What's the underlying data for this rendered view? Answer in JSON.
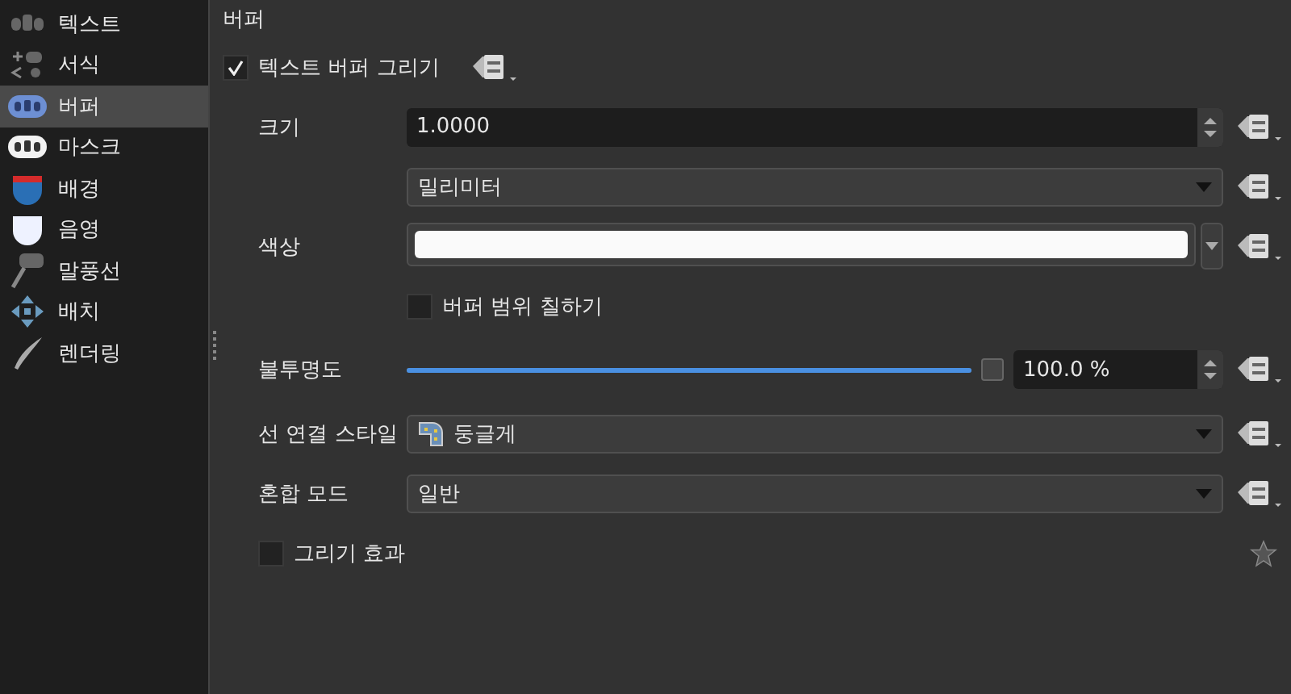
{
  "sidebar": {
    "items": [
      {
        "label": "텍스트",
        "kind": "text",
        "selected": false
      },
      {
        "label": "서식",
        "kind": "format",
        "selected": false
      },
      {
        "label": "버퍼",
        "kind": "buffer",
        "selected": true
      },
      {
        "label": "마스크",
        "kind": "mask",
        "selected": false
      },
      {
        "label": "배경",
        "kind": "background",
        "selected": false
      },
      {
        "label": "음영",
        "kind": "shadow",
        "selected": false
      },
      {
        "label": "말풍선",
        "kind": "callout",
        "selected": false
      },
      {
        "label": "배치",
        "kind": "placement",
        "selected": false
      },
      {
        "label": "렌더링",
        "kind": "rendering",
        "selected": false
      }
    ]
  },
  "panel": {
    "title": "버퍼",
    "enable": {
      "label": "텍스트 버퍼 그리기",
      "checked": true
    },
    "size": {
      "label": "크기",
      "value": "1.0000"
    },
    "unit": {
      "value": "밀리미터"
    },
    "color": {
      "label": "색상"
    },
    "fill": {
      "label": "버퍼 범위 칠하기",
      "checked": false
    },
    "opacity": {
      "label": "불투명도",
      "level": 1,
      "value": "100.0 %"
    },
    "join": {
      "label": "선 연결 스타일",
      "value": "둥글게"
    },
    "blend": {
      "label": "혼합 모드",
      "value": "일반"
    },
    "effects": {
      "label": "그리기 효과",
      "checked": false
    }
  }
}
